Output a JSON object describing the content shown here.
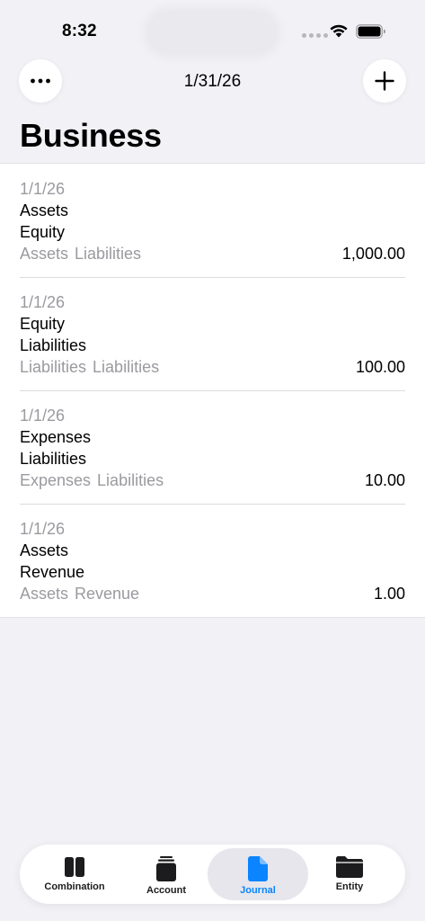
{
  "status_bar": {
    "time": "8:32"
  },
  "nav": {
    "date": "1/31/26",
    "more_icon": "ellipsis-icon",
    "add_icon": "plus-icon"
  },
  "page": {
    "title": "Business"
  },
  "entries": [
    {
      "date": "1/1/26",
      "debit": "Assets",
      "credit": "Equity",
      "accounts": "Assets  Liabilities",
      "amount": "1,000.00"
    },
    {
      "date": "1/1/26",
      "debit": "Equity",
      "credit": "Liabilities",
      "accounts": "Liabilities  Liabilities",
      "amount": "100.00"
    },
    {
      "date": "1/1/26",
      "debit": "Expenses",
      "credit": "Liabilities",
      "accounts": "Expenses  Liabilities",
      "amount": "10.00"
    },
    {
      "date": "1/1/26",
      "debit": "Assets",
      "credit": "Revenue",
      "accounts": "Assets  Revenue",
      "amount": "1.00"
    }
  ],
  "tabs": [
    {
      "label": "Combination",
      "icon": "book-icon",
      "active": false
    },
    {
      "label": "Account",
      "icon": "stack-icon",
      "active": false
    },
    {
      "label": "Journal",
      "icon": "document-icon",
      "active": true
    },
    {
      "label": "Entity",
      "icon": "folder-icon",
      "active": false
    }
  ],
  "colors": {
    "accent": "#0a84ff",
    "background": "#f2f1f6",
    "secondary_text": "#9a9a9f"
  }
}
